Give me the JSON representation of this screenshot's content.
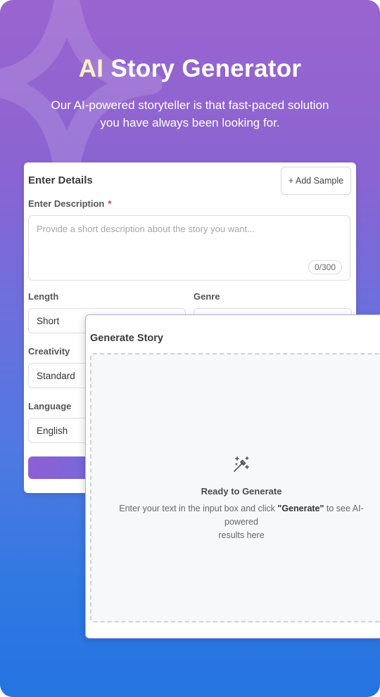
{
  "hero": {
    "title_accent": "AI",
    "title_rest": "Story Generator",
    "subtitle": "Our AI-powered storyteller is that fast-paced solution you have always been looking for."
  },
  "details": {
    "heading": "Enter Details",
    "add_sample": "+ Add Sample",
    "description_label": "Enter Description",
    "required_mark": "*",
    "description_placeholder": "Provide a short description about the story you want...",
    "counter": "0/300",
    "length_label": "Length",
    "length_value": "Short",
    "genre_label": "Genre",
    "creativity_label": "Creativity",
    "creativity_value": "Standard",
    "language_label": "Language",
    "language_value": "English"
  },
  "generate": {
    "heading": "Generate Story",
    "icon": "magic-wand-icon",
    "ready_title": "Ready to Generate",
    "desc_prefix": "Enter your text in the input box and click ",
    "desc_bold": "\"Generate\"",
    "desc_suffix": " to see AI-powered",
    "desc_line2": "results here"
  },
  "colors": {
    "gradient_top": "#9a64cf",
    "gradient_bottom": "#2474e2",
    "title_accent": "#fbf1c6",
    "required": "#e23b3b"
  }
}
